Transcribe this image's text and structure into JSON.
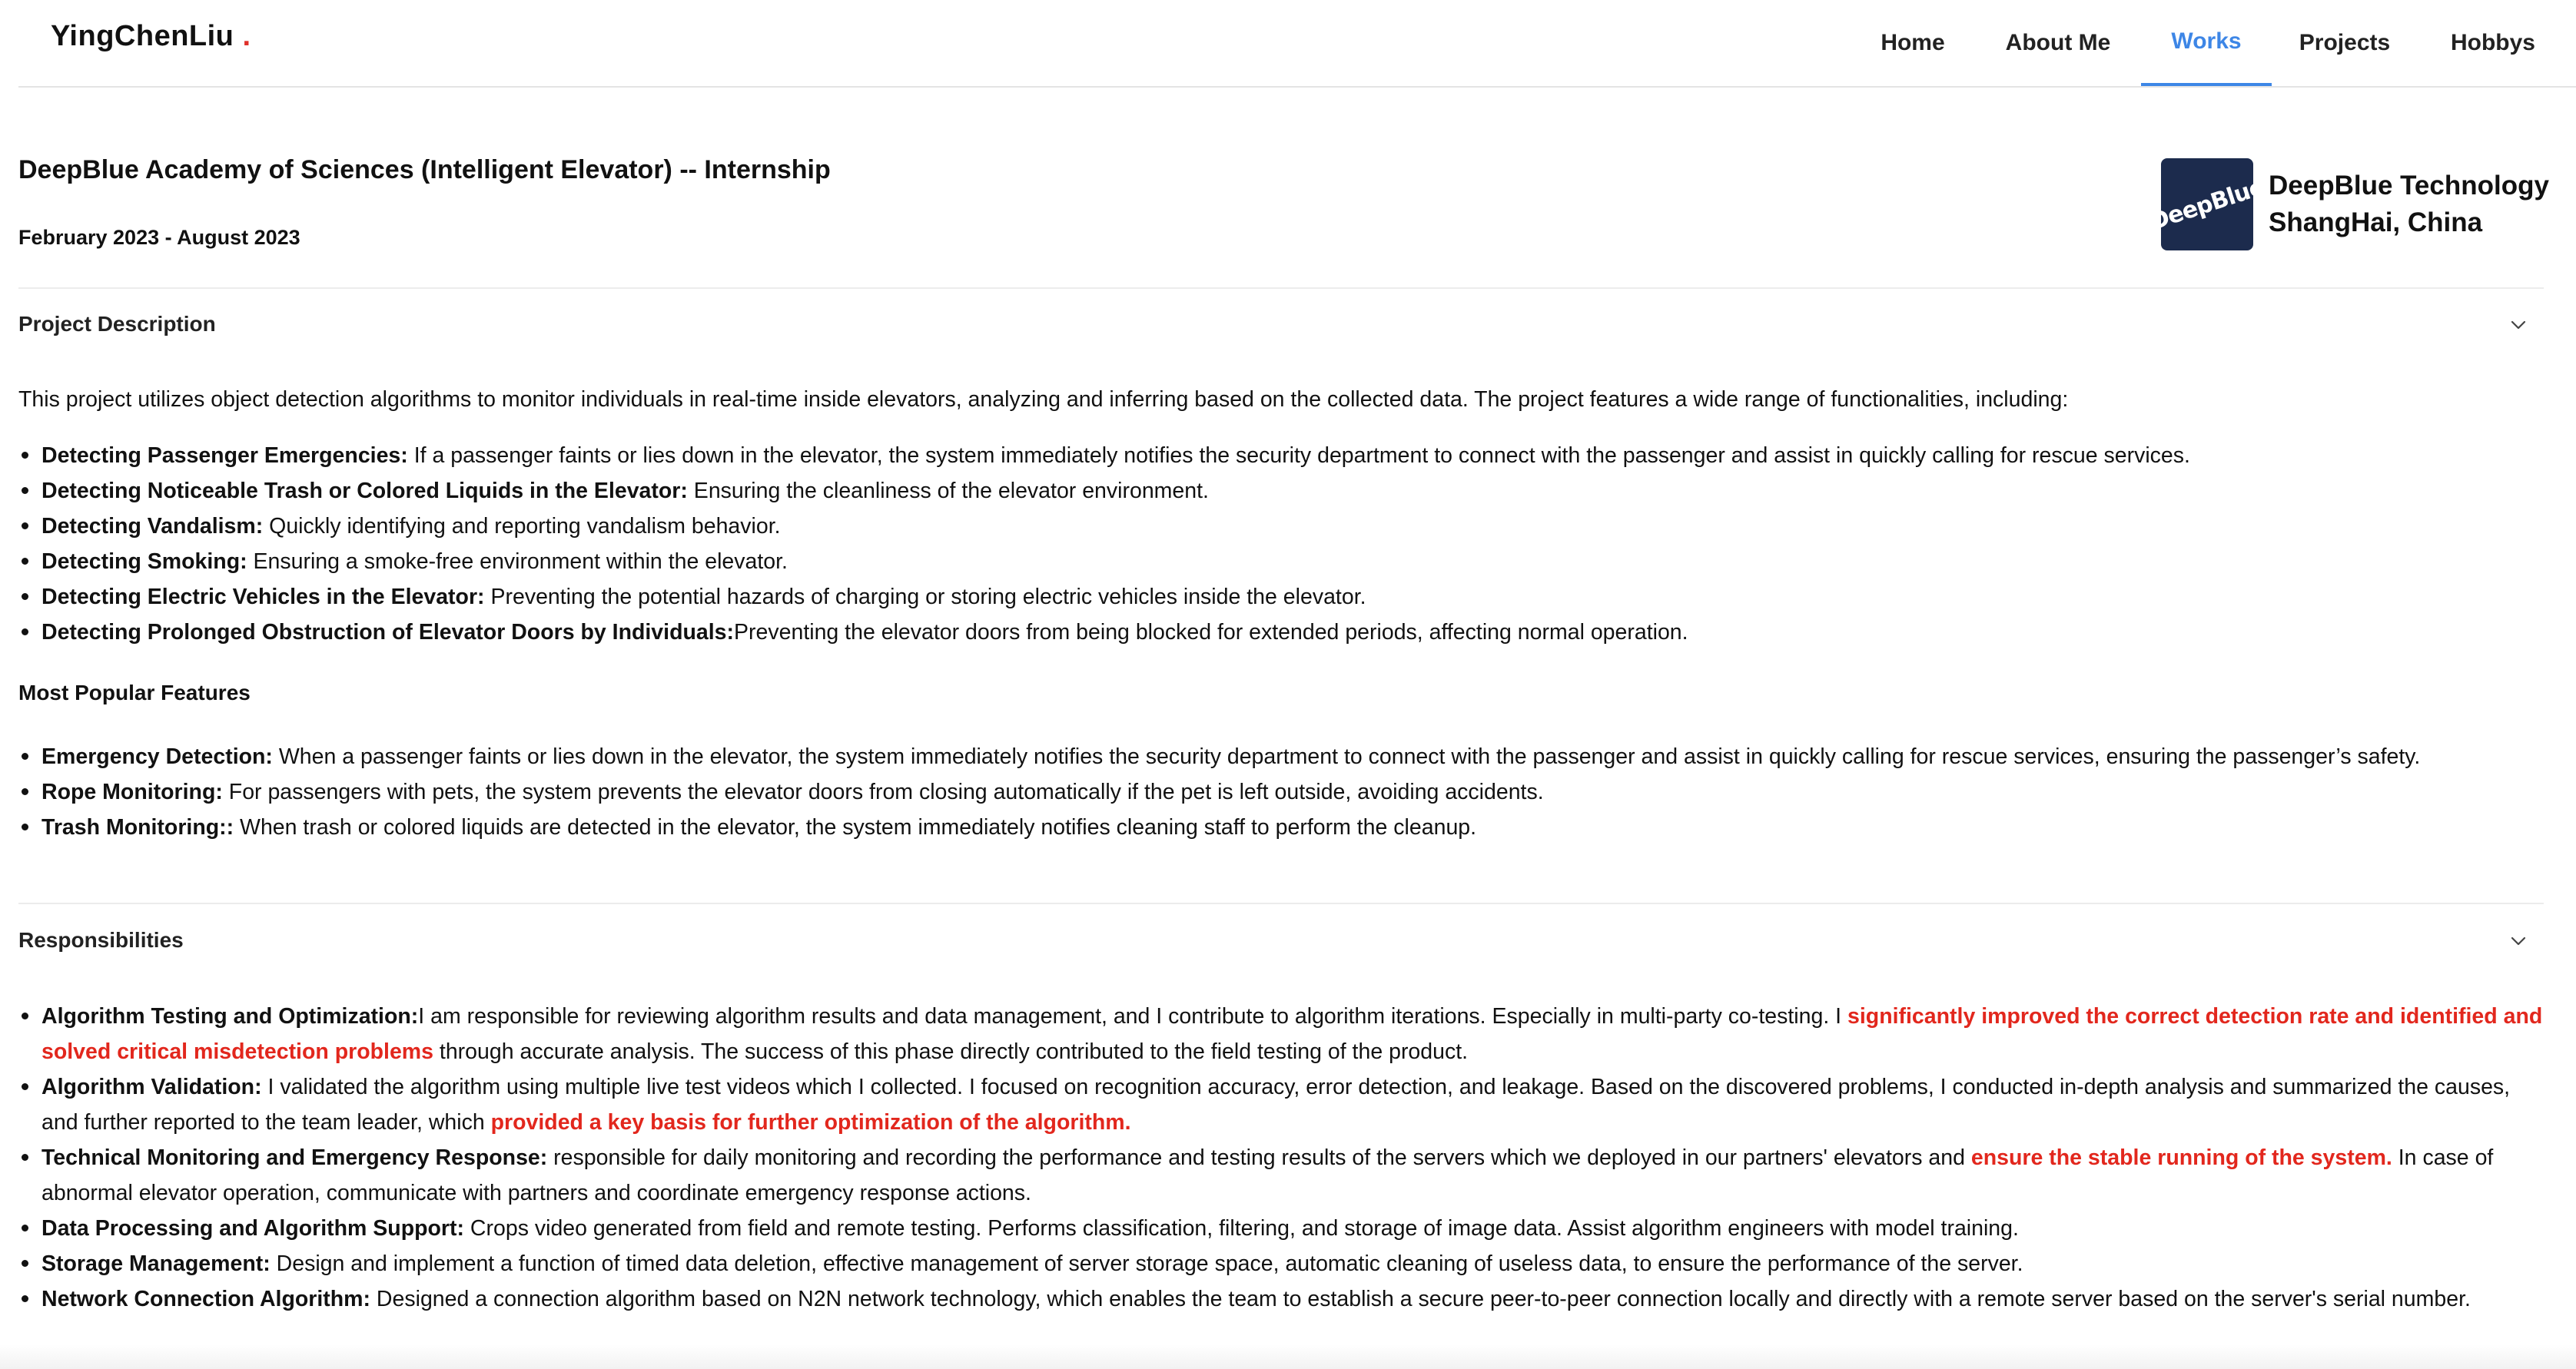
{
  "header": {
    "logo_name": "YingChenLiu",
    "logo_dot": ".",
    "nav": [
      {
        "label": "Home",
        "active": false
      },
      {
        "label": "About Me",
        "active": false
      },
      {
        "label": "Works",
        "active": true
      },
      {
        "label": "Projects",
        "active": false
      },
      {
        "label": "Hobbys",
        "active": false
      }
    ],
    "accent_color": "#3d86e6"
  },
  "job": {
    "title": "DeepBlue Academy of Sciences (Intelligent Elevator) -- Internship",
    "dates": "February 2023 - August 2023",
    "company_logo_text": "DeepBlue",
    "company_name": "DeepBlue Technology",
    "company_location": "ShangHai, China"
  },
  "project_description": {
    "title": "Project Description",
    "chevron_icon": "chevron-down-icon",
    "intro": "This project utilizes object detection algorithms to monitor individuals in real-time inside elevators, analyzing and inferring based on the collected data. The project features a wide range of functionalities, including:",
    "features": [
      {
        "label": "Detecting Passenger Emergencies:",
        "text": " If a passenger faints or lies down in the elevator, the system immediately notifies the security department to connect with the passenger and assist in quickly calling for rescue services."
      },
      {
        "label": "Detecting Noticeable Trash or Colored Liquids in the Elevator:",
        "text": " Ensuring the cleanliness of the elevator environment."
      },
      {
        "label": "Detecting Vandalism:",
        "text": " Quickly identifying and reporting vandalism behavior."
      },
      {
        "label": "Detecting Smoking:",
        "text": " Ensuring a smoke-free environment within the elevator."
      },
      {
        "label": "Detecting Electric Vehicles in the Elevator:",
        "text": " Preventing the potential hazards of charging or storing electric vehicles inside the elevator."
      },
      {
        "label": "Detecting Prolonged Obstruction of Elevator Doors by Individuals:",
        "text": "Preventing the elevator doors from being blocked for extended periods, affecting normal operation."
      }
    ],
    "popular_title": "Most Popular Features",
    "popular": [
      {
        "label": "Emergency Detection:",
        "text": " When a passenger faints or lies down in the elevator, the system immediately notifies the security department to connect with the passenger and assist in quickly calling for rescue services, ensuring the passenger’s safety."
      },
      {
        "label": "Rope Monitoring:",
        "text": " For passengers with pets, the system prevents the elevator doors from closing automatically if the pet is left outside, avoiding accidents."
      },
      {
        "label": "Trash Monitoring::",
        "text": " When trash or colored liquids are detected in the elevator, the system immediately notifies cleaning staff to perform the cleanup."
      }
    ]
  },
  "responsibilities": {
    "title": "Responsibilities",
    "chevron_icon": "chevron-down-icon",
    "highlight_color": "#e2271d",
    "items": [
      {
        "label": "Algorithm Testing and Optimization:",
        "text1": "I am responsible for reviewing algorithm results and data management, and I contribute to algorithm iterations. Especially in multi-party co-testing. I ",
        "highlight": "significantly improved the correct detection rate and identified and solved critical misdetection problems",
        "text2": " through accurate analysis. The success of this phase directly contributed to the field testing of the product."
      },
      {
        "label": "Algorithm Validation:",
        "text1": " I validated the algorithm using multiple live test videos which I collected. I focused on recognition accuracy, error detection, and leakage. Based on the discovered problems, I conducted in-depth analysis and summarized the causes, and further reported to the team leader, which ",
        "highlight": "provided a key basis for further optimization of the algorithm.",
        "text2": ""
      },
      {
        "label": "Technical Monitoring and Emergency Response:",
        "text1": " responsible for daily monitoring and recording the performance and testing results of the servers which we deployed in our partners' elevators and ",
        "highlight": "ensure the stable running of the system.",
        "text2": " In case of abnormal elevator operation, communicate with partners and coordinate emergency response actions."
      },
      {
        "label": "Data Processing and Algorithm Support:",
        "text1": " Crops video generated from field and remote testing. Performs classification, filtering, and storage of image data. Assist algorithm engineers with model training.",
        "highlight": "",
        "text2": ""
      },
      {
        "label": "Storage Management:",
        "text1": " Design and implement a function of timed data deletion, effective management of server storage space, automatic cleaning of useless data, to ensure the performance of the server.",
        "highlight": "",
        "text2": ""
      },
      {
        "label": "Network Connection Algorithm:",
        "text1": " Designed a connection algorithm based on N2N network technology, which enables the team to establish a secure peer-to-peer connection locally and directly with a remote server based on the server's serial number.",
        "highlight": "",
        "text2": ""
      }
    ]
  }
}
